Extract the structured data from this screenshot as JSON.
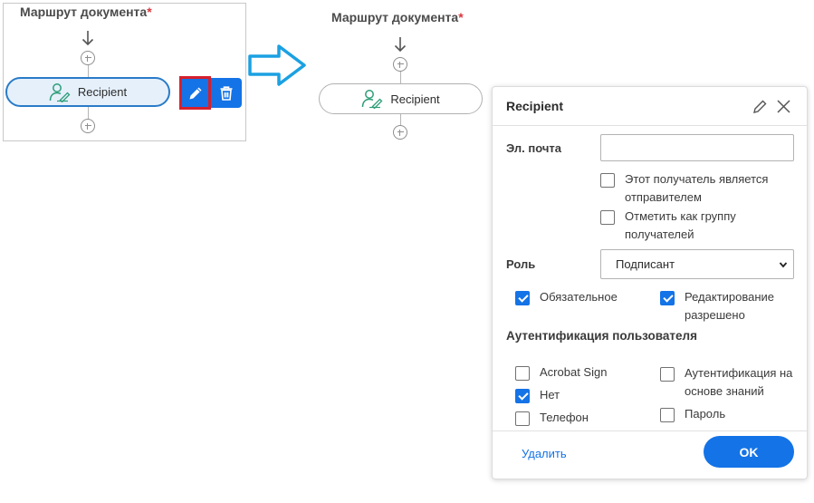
{
  "left_panel": {
    "title": "Маршрут документа",
    "required_mark": "*",
    "recipient_label": "Recipient"
  },
  "right_route": {
    "title": "Маршрут документа",
    "required_mark": "*",
    "recipient_label": "Recipient"
  },
  "popover": {
    "title": "Recipient",
    "email": {
      "label": "Эл. почта",
      "value": "",
      "placeholder": ""
    },
    "sender_checkbox": {
      "label_line1": "Этот получатель является",
      "label_line2": "отправителем",
      "checked": false
    },
    "group_checkbox": {
      "label_line1": "Отметить как группу",
      "label_line2": "получателей",
      "checked": false
    },
    "role": {
      "label": "Роль",
      "selected": "Подписант"
    },
    "required_checkbox": {
      "label": "Обязательное",
      "checked": true
    },
    "edit_checkbox": {
      "label_line1": "Редактирование",
      "label_line2": "разрешено",
      "checked": true
    },
    "auth_section": {
      "title": "Аутентификация пользователя",
      "options": {
        "acrobat_sign": {
          "label": "Acrobat Sign",
          "checked": false
        },
        "none": {
          "label": "Нет",
          "checked": true
        },
        "phone": {
          "label": "Телефон",
          "checked": false
        },
        "kba": {
          "label_line1": "Аутентификация на",
          "label_line2": "основе знаний",
          "checked": false
        },
        "password": {
          "label": "Пароль",
          "checked": false
        }
      }
    },
    "delete_link": "Удалить",
    "ok_button": "OK"
  },
  "colors": {
    "accent": "#1473e6",
    "required": "#d7373f",
    "highlight_border": "#d7202c",
    "transition_arrow": "#1ba1e2",
    "recipient_icon": "#2d9d78"
  },
  "icons": {
    "arrow_down": "arrow-down-icon",
    "add": "add-circle-icon",
    "recipient": "user-sign-icon",
    "edit": "pencil-icon",
    "delete": "trash-icon",
    "transition": "right-arrow-icon",
    "close": "close-icon",
    "chevron": "chevron-down-icon"
  }
}
